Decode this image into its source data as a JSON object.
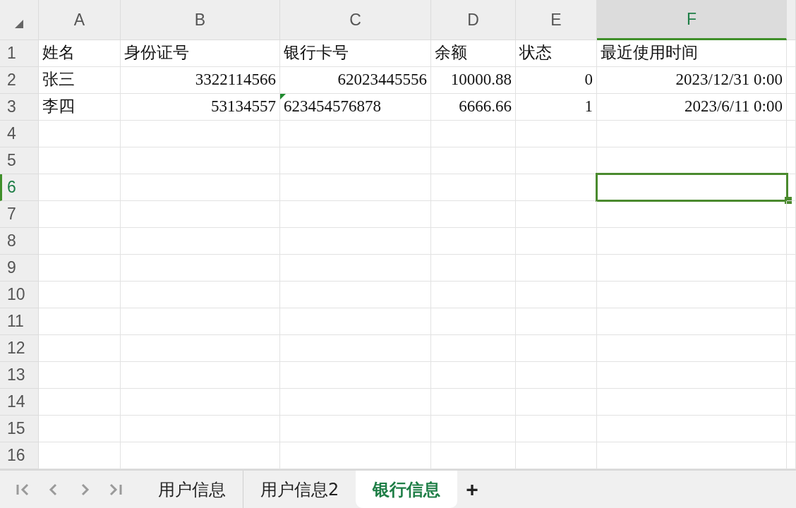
{
  "columns": [
    {
      "label": "A",
      "selected": false
    },
    {
      "label": "B",
      "selected": false
    },
    {
      "label": "C",
      "selected": false
    },
    {
      "label": "D",
      "selected": false
    },
    {
      "label": "E",
      "selected": false
    },
    {
      "label": "F",
      "selected": true
    }
  ],
  "rows": [
    {
      "label": "1",
      "selected": false,
      "cells": [
        {
          "text": "姓名",
          "kind": "text"
        },
        {
          "text": "身份证号",
          "kind": "text"
        },
        {
          "text": "银行卡号",
          "kind": "text"
        },
        {
          "text": "余额",
          "kind": "text"
        },
        {
          "text": "状态",
          "kind": "text"
        },
        {
          "text": "最近使用时间",
          "kind": "text"
        }
      ]
    },
    {
      "label": "2",
      "selected": false,
      "cells": [
        {
          "text": "张三",
          "kind": "text"
        },
        {
          "text": "3322114566",
          "kind": "number"
        },
        {
          "text": "62023445556",
          "kind": "number"
        },
        {
          "text": "10000.88",
          "kind": "number"
        },
        {
          "text": "0",
          "kind": "number"
        },
        {
          "text": "2023/12/31 0:00",
          "kind": "number"
        }
      ]
    },
    {
      "label": "3",
      "selected": false,
      "cells": [
        {
          "text": "李四",
          "kind": "text"
        },
        {
          "text": "53134557",
          "kind": "number"
        },
        {
          "text": "623454576878",
          "kind": "number-text"
        },
        {
          "text": "6666.66",
          "kind": "number"
        },
        {
          "text": "1",
          "kind": "number"
        },
        {
          "text": "2023/6/11 0:00",
          "kind": "number"
        }
      ]
    },
    {
      "label": "4",
      "selected": false,
      "cells": []
    },
    {
      "label": "5",
      "selected": false,
      "cells": []
    },
    {
      "label": "6",
      "selected": true,
      "cells": []
    },
    {
      "label": "7",
      "selected": false,
      "cells": []
    },
    {
      "label": "8",
      "selected": false,
      "cells": []
    },
    {
      "label": "9",
      "selected": false,
      "cells": []
    },
    {
      "label": "10",
      "selected": false,
      "cells": []
    },
    {
      "label": "11",
      "selected": false,
      "cells": []
    },
    {
      "label": "12",
      "selected": false,
      "cells": []
    },
    {
      "label": "13",
      "selected": false,
      "cells": []
    },
    {
      "label": "14",
      "selected": false,
      "cells": []
    },
    {
      "label": "15",
      "selected": false,
      "cells": []
    },
    {
      "label": "16",
      "selected": false,
      "cells": []
    }
  ],
  "sheet_tabs": [
    {
      "label": "用户信息",
      "selected": false
    },
    {
      "label": "用户信息2",
      "selected": false
    },
    {
      "label": "银行信息",
      "selected": true
    }
  ],
  "add_sheet": "+"
}
